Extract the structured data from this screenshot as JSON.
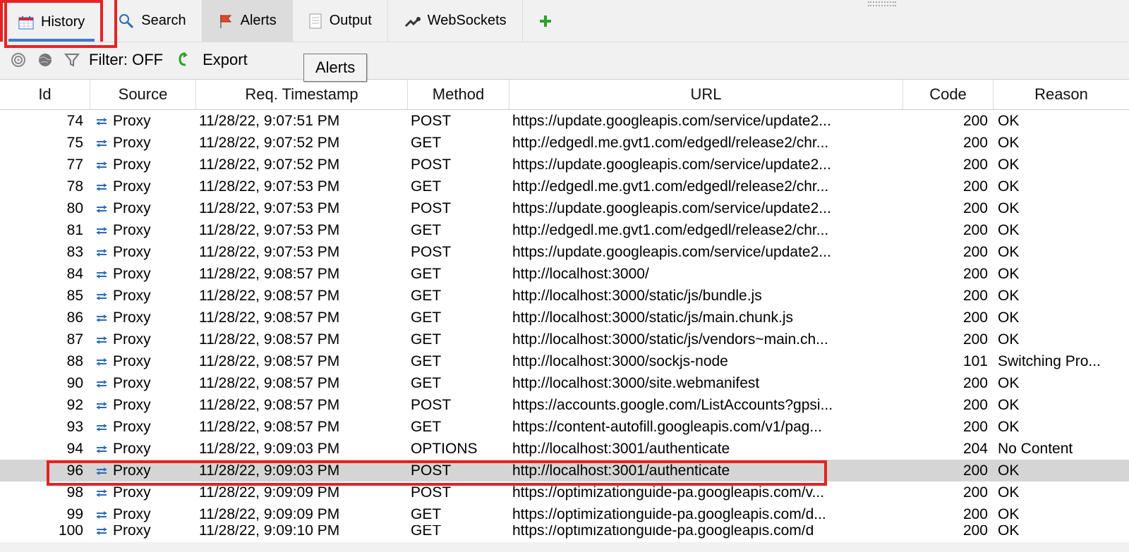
{
  "tabs": {
    "history": "History",
    "search": "Search",
    "alerts": "Alerts",
    "output": "Output",
    "websockets": "WebSockets"
  },
  "toolbar": {
    "filter_label": "Filter: OFF",
    "export_label": "Export",
    "tooltip": "Alerts"
  },
  "columns": {
    "id": "Id",
    "source": "Source",
    "timestamp": "Req. Timestamp",
    "method": "Method",
    "url": "URL",
    "code": "Code",
    "reason": "Reason"
  },
  "rows": [
    {
      "id": "74",
      "src": "Proxy",
      "ts": "11/28/22, 9:07:51 PM",
      "m": "POST",
      "u": "https://update.googleapis.com/service/update2...",
      "c": "200",
      "r": "OK"
    },
    {
      "id": "75",
      "src": "Proxy",
      "ts": "11/28/22, 9:07:52 PM",
      "m": "GET",
      "u": "http://edgedl.me.gvt1.com/edgedl/release2/chr...",
      "c": "200",
      "r": "OK"
    },
    {
      "id": "77",
      "src": "Proxy",
      "ts": "11/28/22, 9:07:52 PM",
      "m": "POST",
      "u": "https://update.googleapis.com/service/update2...",
      "c": "200",
      "r": "OK"
    },
    {
      "id": "78",
      "src": "Proxy",
      "ts": "11/28/22, 9:07:53 PM",
      "m": "GET",
      "u": "http://edgedl.me.gvt1.com/edgedl/release2/chr...",
      "c": "200",
      "r": "OK"
    },
    {
      "id": "80",
      "src": "Proxy",
      "ts": "11/28/22, 9:07:53 PM",
      "m": "POST",
      "u": "https://update.googleapis.com/service/update2...",
      "c": "200",
      "r": "OK"
    },
    {
      "id": "81",
      "src": "Proxy",
      "ts": "11/28/22, 9:07:53 PM",
      "m": "GET",
      "u": "http://edgedl.me.gvt1.com/edgedl/release2/chr...",
      "c": "200",
      "r": "OK"
    },
    {
      "id": "83",
      "src": "Proxy",
      "ts": "11/28/22, 9:07:53 PM",
      "m": "POST",
      "u": "https://update.googleapis.com/service/update2...",
      "c": "200",
      "r": "OK"
    },
    {
      "id": "84",
      "src": "Proxy",
      "ts": "11/28/22, 9:08:57 PM",
      "m": "GET",
      "u": "http://localhost:3000/",
      "c": "200",
      "r": "OK"
    },
    {
      "id": "85",
      "src": "Proxy",
      "ts": "11/28/22, 9:08:57 PM",
      "m": "GET",
      "u": "http://localhost:3000/static/js/bundle.js",
      "c": "200",
      "r": "OK"
    },
    {
      "id": "86",
      "src": "Proxy",
      "ts": "11/28/22, 9:08:57 PM",
      "m": "GET",
      "u": "http://localhost:3000/static/js/main.chunk.js",
      "c": "200",
      "r": "OK"
    },
    {
      "id": "87",
      "src": "Proxy",
      "ts": "11/28/22, 9:08:57 PM",
      "m": "GET",
      "u": "http://localhost:3000/static/js/vendors~main.ch...",
      "c": "200",
      "r": "OK"
    },
    {
      "id": "88",
      "src": "Proxy",
      "ts": "11/28/22, 9:08:57 PM",
      "m": "GET",
      "u": "http://localhost:3000/sockjs-node",
      "c": "101",
      "r": "Switching Pro..."
    },
    {
      "id": "90",
      "src": "Proxy",
      "ts": "11/28/22, 9:08:57 PM",
      "m": "GET",
      "u": "http://localhost:3000/site.webmanifest",
      "c": "200",
      "r": "OK"
    },
    {
      "id": "92",
      "src": "Proxy",
      "ts": "11/28/22, 9:08:57 PM",
      "m": "POST",
      "u": "https://accounts.google.com/ListAccounts?gpsi...",
      "c": "200",
      "r": "OK"
    },
    {
      "id": "93",
      "src": "Proxy",
      "ts": "11/28/22, 9:08:57 PM",
      "m": "GET",
      "u": "https://content-autofill.googleapis.com/v1/pag...",
      "c": "200",
      "r": "OK"
    },
    {
      "id": "94",
      "src": "Proxy",
      "ts": "11/28/22, 9:09:03 PM",
      "m": "OPTIONS",
      "u": "http://localhost:3001/authenticate",
      "c": "204",
      "r": "No Content"
    },
    {
      "id": "96",
      "src": "Proxy",
      "ts": "11/28/22, 9:09:03 PM",
      "m": "POST",
      "u": "http://localhost:3001/authenticate",
      "c": "200",
      "r": "OK",
      "sel": true
    },
    {
      "id": "98",
      "src": "Proxy",
      "ts": "11/28/22, 9:09:09 PM",
      "m": "POST",
      "u": "https://optimizationguide-pa.googleapis.com/v...",
      "c": "200",
      "r": "OK"
    },
    {
      "id": "99",
      "src": "Proxy",
      "ts": "11/28/22, 9:09:09 PM",
      "m": "GET",
      "u": "https://optimizationguide-pa.googleapis.com/d...",
      "c": "200",
      "r": "OK"
    },
    {
      "id": "100",
      "src": "Proxy",
      "ts": "11/28/22, 9:09:10 PM",
      "m": "GET",
      "u": "https://optimizationguide-pa.googleapis.com/d",
      "c": "200",
      "r": "OK",
      "cut": true
    }
  ]
}
